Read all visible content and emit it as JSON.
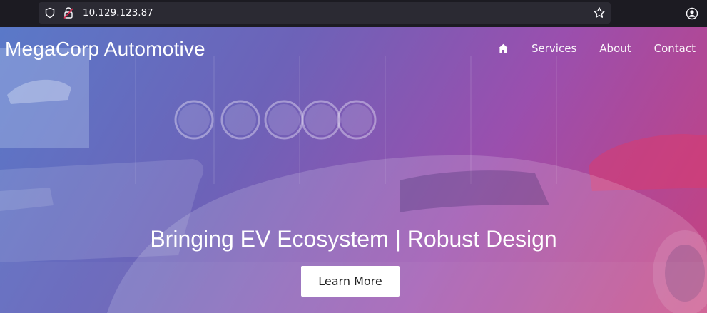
{
  "browser": {
    "url": "10.129.123.87"
  },
  "site": {
    "brand": "MegaCorp Automotive",
    "nav": [
      {
        "label": "Services"
      },
      {
        "label": "About"
      },
      {
        "label": "Contact"
      }
    ],
    "headline": "Bringing EV Ecosystem | Robust Design",
    "cta_label": "Learn More"
  },
  "colors": {
    "gradient_start": "#5a79c8",
    "gradient_end": "#c7417e",
    "chrome_bg": "#1c1b22",
    "urlbar_bg": "#2b2a33",
    "lock_warning": "#e22850"
  },
  "icons": {
    "tracking": "shield-icon",
    "security": "insecure-lock-icon",
    "bookmark": "star-icon",
    "account": "account-icon",
    "home": "home-icon"
  }
}
